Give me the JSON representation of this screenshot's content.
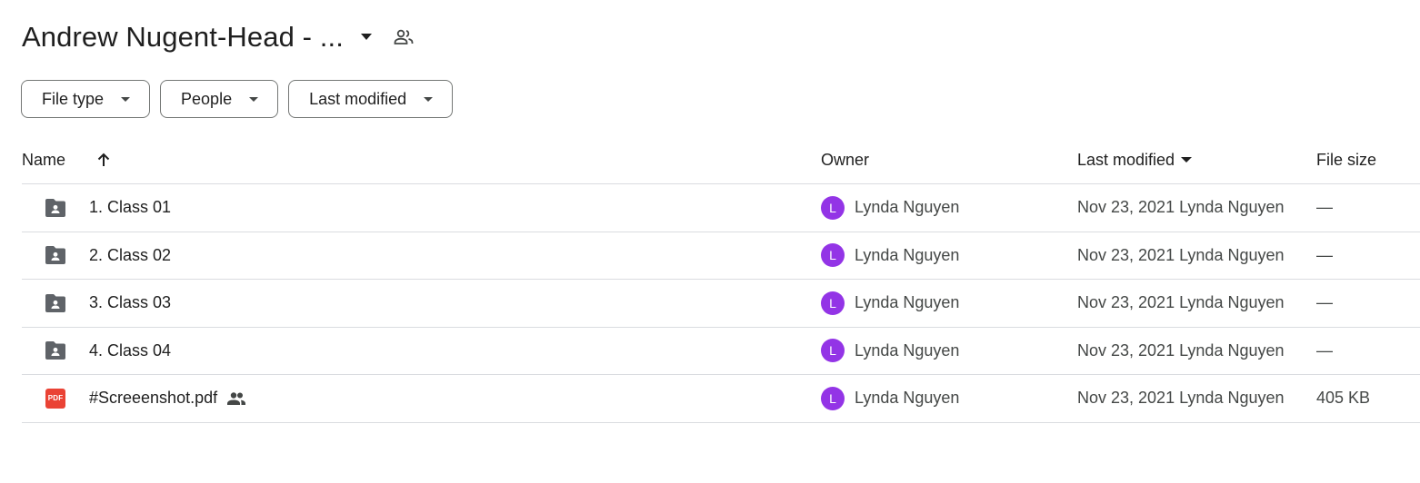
{
  "header": {
    "title": "Andrew Nugent-Head - ...",
    "title_dropdown_icon": "caret-down-icon",
    "shared_icon": "people-outline-icon"
  },
  "filters": [
    {
      "label": "File type"
    },
    {
      "label": "People"
    },
    {
      "label": "Last modified"
    }
  ],
  "table": {
    "columns": {
      "name": "Name",
      "owner": "Owner",
      "last_modified": "Last modified",
      "file_size": "File size"
    },
    "rows": [
      {
        "icon": "shared-folder-icon",
        "name": "1. Class 01",
        "shared": false,
        "owner_initial": "L",
        "owner": "Lynda Nguyen",
        "modified": "Nov 23, 2021 Lynda Nguyen",
        "size": "—"
      },
      {
        "icon": "shared-folder-icon",
        "name": "2. Class 02",
        "shared": false,
        "owner_initial": "L",
        "owner": "Lynda Nguyen",
        "modified": "Nov 23, 2021 Lynda Nguyen",
        "size": "—"
      },
      {
        "icon": "shared-folder-icon",
        "name": "3. Class 03",
        "shared": false,
        "owner_initial": "L",
        "owner": "Lynda Nguyen",
        "modified": "Nov 23, 2021 Lynda Nguyen",
        "size": "—"
      },
      {
        "icon": "shared-folder-icon",
        "name": "4. Class 04",
        "shared": false,
        "owner_initial": "L",
        "owner": "Lynda Nguyen",
        "modified": "Nov 23, 2021 Lynda Nguyen",
        "size": "—"
      },
      {
        "icon": "pdf-icon",
        "icon_text": "PDF",
        "name": "#Screeenshot.pdf",
        "shared": true,
        "owner_initial": "L",
        "owner": "Lynda Nguyen",
        "modified": "Nov 23, 2021 Lynda Nguyen",
        "size": "405 KB"
      }
    ]
  },
  "colors": {
    "avatar": "#9334e6",
    "pdf": "#ea4335",
    "folder_icon": "#5f6368",
    "divider": "#dadce0"
  }
}
